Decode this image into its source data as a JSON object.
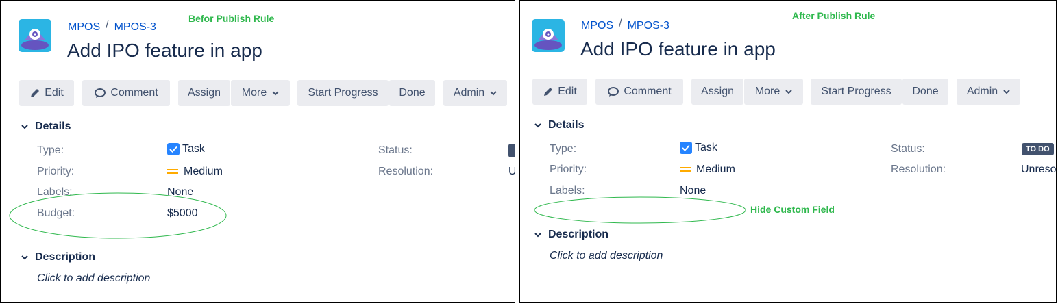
{
  "colors": {
    "link": "#0052cc",
    "annotation": "#2fb84d",
    "button_bg": "#ebecf0",
    "checkbox": "#2684ff",
    "priority_medium": "#ffab00",
    "status_lozenge": "#42526e"
  },
  "before": {
    "annotation": "Befor Publish Rule",
    "breadcrumb": {
      "project": "MPOS",
      "separator": "/",
      "issue_key": "MPOS-3"
    },
    "title": "Add IPO feature in app",
    "toolbar": {
      "edit": "Edit",
      "comment": "Comment",
      "assign": "Assign",
      "more": "More",
      "start_progress": "Start Progress",
      "done": "Done",
      "admin": "Admin"
    },
    "details": {
      "heading": "Details",
      "type_label": "Type:",
      "type_value": "Task",
      "priority_label": "Priority:",
      "priority_value": "Medium",
      "labels_label": "Labels:",
      "labels_value": "None",
      "budget_label": "Budget:",
      "budget_value": "$5000",
      "status_label": "Status:",
      "resolution_label": "Resolution:",
      "resolution_value": "U"
    },
    "description": {
      "heading": "Description",
      "placeholder": "Click to add description"
    }
  },
  "after": {
    "annotation": "After Publish Rule",
    "hidden_note": "Hide Custom Field",
    "breadcrumb": {
      "project": "MPOS",
      "separator": "/",
      "issue_key": "MPOS-3"
    },
    "title": "Add IPO feature in app",
    "toolbar": {
      "edit": "Edit",
      "comment": "Comment",
      "assign": "Assign",
      "more": "More",
      "start_progress": "Start Progress",
      "done": "Done",
      "admin": "Admin"
    },
    "details": {
      "heading": "Details",
      "type_label": "Type:",
      "type_value": "Task",
      "priority_label": "Priority:",
      "priority_value": "Medium",
      "labels_label": "Labels:",
      "labels_value": "None",
      "status_label": "Status:",
      "status_value": "TO DO",
      "resolution_label": "Resolution:",
      "resolution_value": "Unreso"
    },
    "description": {
      "heading": "Description",
      "placeholder": "Click to add description"
    }
  }
}
